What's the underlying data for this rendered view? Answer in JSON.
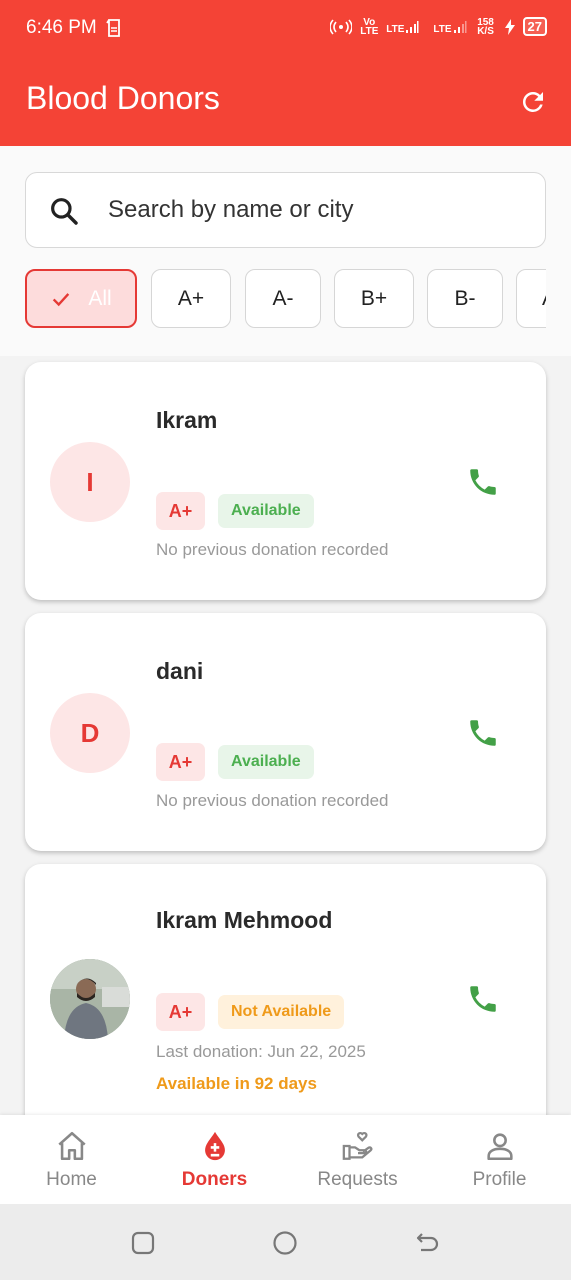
{
  "status_bar": {
    "time": "6:46 PM",
    "volte": "Vo LTE",
    "lte1": "LTE",
    "lte2": "LTE",
    "speed": "158 K/S",
    "battery": "27"
  },
  "app_bar": {
    "title": "Blood Donors",
    "refresh_icon": "refresh-icon"
  },
  "search": {
    "placeholder": "Search by name or city",
    "value": ""
  },
  "filters": {
    "chips": [
      {
        "label": "All",
        "selected": true
      },
      {
        "label": "A+",
        "selected": false
      },
      {
        "label": "A-",
        "selected": false
      },
      {
        "label": "B+",
        "selected": false
      },
      {
        "label": "B-",
        "selected": false
      },
      {
        "label": "A",
        "selected": false
      }
    ]
  },
  "donors": [
    {
      "initial": "I",
      "name": "Ikram",
      "blood_group": "A+",
      "status": "Available",
      "donation_text": "No previous donation recorded",
      "available_in": ""
    },
    {
      "initial": "D",
      "name": "dani",
      "blood_group": "A+",
      "status": "Available",
      "donation_text": "No previous donation recorded",
      "available_in": ""
    },
    {
      "initial": "",
      "name": "Ikram Mehmood",
      "blood_group": "A+",
      "status": "Not Available",
      "donation_text": "Last donation: Jun 22, 2025",
      "available_in": "Available in 92 days"
    }
  ],
  "bottom_nav": {
    "items": [
      {
        "label": "Home",
        "icon": "home-icon",
        "active": false
      },
      {
        "label": "Doners",
        "icon": "blood-drop-icon",
        "active": true
      },
      {
        "label": "Requests",
        "icon": "hand-heart-icon",
        "active": false
      },
      {
        "label": "Profile",
        "icon": "person-icon",
        "active": false
      }
    ]
  },
  "colors": {
    "primary": "#f44336",
    "accent_red": "#e53935",
    "available_green": "#4caf50",
    "unavailable_orange": "#ef9a1a"
  }
}
